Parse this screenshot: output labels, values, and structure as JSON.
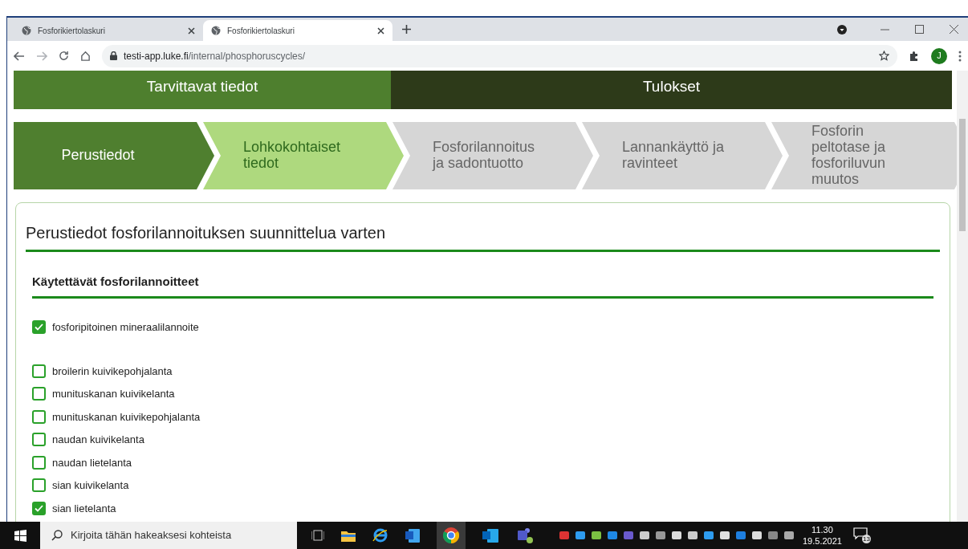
{
  "browser": {
    "tabs": [
      {
        "title": "Fosforikiertolaskuri",
        "selected": false
      },
      {
        "title": "Fosforikiertolaskuri",
        "selected": true
      }
    ],
    "address": {
      "host": "testi-app.luke.fi",
      "path": "/internal/phosphoruscycles/"
    },
    "profile_initial": "J"
  },
  "header_tabs": [
    {
      "label": "Tarvittavat tiedot",
      "selected": true
    },
    {
      "label": "Tulokset",
      "selected": false
    }
  ],
  "steps": [
    {
      "label": "Perustiedot",
      "kind": "current"
    },
    {
      "label": "Lohkokohtaiset tiedot",
      "kind": "available"
    },
    {
      "label": "Fosforilannoitus ja sadontuotto",
      "kind": "locked"
    },
    {
      "label": "Lannankäyttö ja ravinteet",
      "kind": "locked"
    },
    {
      "label": "Fosforin peltotase ja fosforiluvun muutos",
      "kind": "locked"
    }
  ],
  "card": {
    "title": "Perustiedot fosforilannoituksen suunnittelua varten",
    "section_title": "Käytettävät fosforilannoitteet",
    "options": [
      {
        "label": "fosforipitoinen mineraalilannoite",
        "checked": true
      },
      {
        "label": "broilerin kuivikepohjalanta",
        "checked": false
      },
      {
        "label": "munituskanan kuivikelanta",
        "checked": false
      },
      {
        "label": "munituskanan kuivikepohjalanta",
        "checked": false
      },
      {
        "label": "naudan kuivikelanta",
        "checked": false
      },
      {
        "label": "naudan lietelanta",
        "checked": false
      },
      {
        "label": "sian kuivikelanta",
        "checked": false
      },
      {
        "label": "sian lietelanta",
        "checked": true
      }
    ]
  },
  "taskbar": {
    "search_placeholder": "Kirjoita tähän hakeaksesi kohteista",
    "time": "11.30",
    "date": "19.5.2021",
    "notification_count": "13"
  }
}
